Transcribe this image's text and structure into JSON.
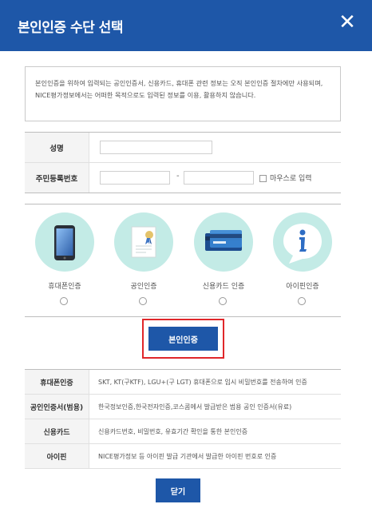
{
  "header": {
    "title": "본인인증 수단 선택",
    "close_icon": "close-icon"
  },
  "notice": {
    "text": "본인인증을 위하여 입력되는 공인인증서, 신용카드, 휴대폰 관련 정보는 오직 본인인증 절차에만 사용되며, NICE평가정보에서는 어떠한 목적으로도 입력된 정보를 이용, 활용하지 않습니다."
  },
  "form": {
    "name_label": "성명",
    "name_value": "",
    "rrn_label": "주민등록번호",
    "rrn_front_value": "",
    "rrn_separator": "-",
    "rrn_back_value": "",
    "mouse_input_label": "마우스로 입력"
  },
  "methods": [
    {
      "label": "휴대폰인증",
      "icon": "phone-icon"
    },
    {
      "label": "공인인증",
      "icon": "certificate-icon"
    },
    {
      "label": "신용카드 인증",
      "icon": "credit-card-icon"
    },
    {
      "label": "아이핀인증",
      "icon": "info-bubble-icon"
    }
  ],
  "auth_button": "본인인증",
  "descriptions": [
    {
      "label": "휴대폰인증",
      "text": "SKT, KT(구KTF), LGU+(구 LGT) 휴대폰으로 임시 비밀번호를 전송하여 인증"
    },
    {
      "label": "공인인증서(범용)",
      "text": "한국정보인증,한국전자인증,코스콤에서 발급받은 범용 공인 인증서(유료)"
    },
    {
      "label": "신용카드",
      "text": "신용카드번호, 비밀번호, 유효기간 확인을 통한 본인인증"
    },
    {
      "label": "아이핀",
      "text": "NICE평가정보 등 아이핀 발급 기관에서 발급한 아이핀 번호로 인증"
    }
  ],
  "close_button": "닫기",
  "colors": {
    "primary": "#1e57a8",
    "highlight": "#e0272a",
    "icon_bg": "#c3ebe6"
  }
}
